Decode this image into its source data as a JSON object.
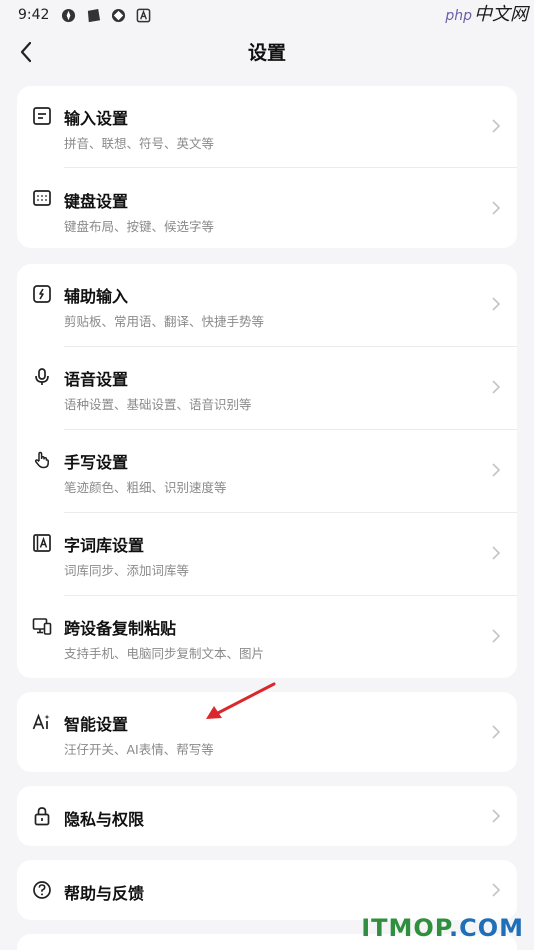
{
  "status_bar": {
    "time": "9:42"
  },
  "watermark_top": {
    "php": "php",
    "cn": "中文网"
  },
  "header": {
    "title": "设置"
  },
  "sections": [
    {
      "items": [
        {
          "title": "输入设置",
          "sub": "拼音、联想、符号、英文等",
          "icon": "document-icon"
        },
        {
          "title": "键盘设置",
          "sub": "键盘布局、按键、候选字等",
          "icon": "keyboard-icon"
        }
      ]
    },
    {
      "items": [
        {
          "title": "辅助输入",
          "sub": "剪贴板、常用语、翻译、快捷手势等",
          "icon": "edit-icon"
        },
        {
          "title": "语音设置",
          "sub": "语种设置、基础设置、语音识别等",
          "icon": "microphone-icon"
        },
        {
          "title": "手写设置",
          "sub": "笔迹颜色、粗细、识别速度等",
          "icon": "hand-icon"
        },
        {
          "title": "字词库设置",
          "sub": "词库同步、添加词库等",
          "icon": "dictionary-icon"
        },
        {
          "title": "跨设备复制粘贴",
          "sub": "支持手机、电脑同步复制文本、图片",
          "icon": "devices-icon"
        }
      ]
    },
    {
      "items": [
        {
          "title": "智能设置",
          "sub": "汪仔开关、AI表情、帮写等",
          "icon": "ai-icon"
        }
      ]
    },
    {
      "items": [
        {
          "title": "隐私与权限",
          "icon": "lock-icon"
        }
      ]
    },
    {
      "items": [
        {
          "title": "帮助与反馈",
          "icon": "help-icon"
        }
      ]
    }
  ],
  "watermark_bottom": {
    "brand_a": "ITMOP",
    "brand_b": ".COM"
  },
  "colors": {
    "background": "#f5f5f7",
    "card": "#ffffff",
    "annotation_arrow": "#d9292d",
    "watermark_green": "#2f8f3f"
  }
}
